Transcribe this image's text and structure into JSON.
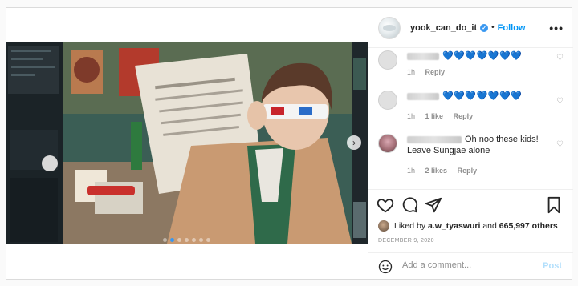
{
  "post": {
    "username": "yook_can_do_it",
    "follow_label": "Follow",
    "more_label": "•••"
  },
  "comments": [
    {
      "name_visible": false,
      "text": "💙💙💙💙💙💙💙",
      "time": "1h",
      "likes": "",
      "reply": "Reply"
    },
    {
      "name_visible": false,
      "text": "💙💙💙💙💙💙💙",
      "time": "1h",
      "likes": "1 like",
      "reply": "Reply"
    },
    {
      "name_visible": false,
      "text": "Oh noo these kids! Leave Sungjae alone",
      "time": "1h",
      "likes": "2 likes",
      "reply": "Reply"
    }
  ],
  "likes": {
    "prefix": "Liked by",
    "user": "a.w_tyaswuri",
    "conj": "and",
    "others": "665,997 others"
  },
  "date": "DECEMBER 9, 2020",
  "add_comment": {
    "placeholder": "Add a comment...",
    "post_label": "Post"
  },
  "icons": {
    "like": "heart-icon",
    "comment": "comment-icon",
    "share": "paper-plane-icon",
    "save": "bookmark-icon",
    "emoji": "smiley-icon",
    "next": "chevron-right-icon",
    "verified": "verified-badge-icon"
  },
  "colors": {
    "accent": "#0095f6",
    "hearts": "#1fb3c9",
    "muted": "#8e8e8e"
  },
  "carousel": {
    "count": 7,
    "active": 1
  }
}
